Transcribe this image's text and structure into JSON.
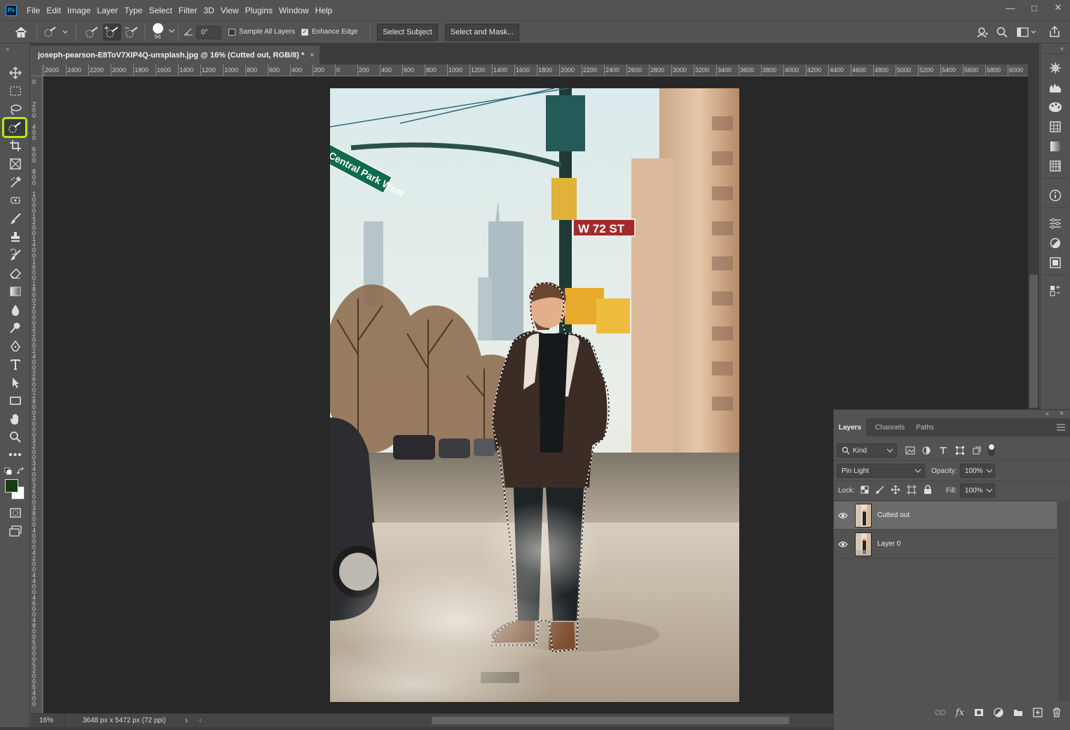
{
  "app": {
    "logo_text": "Ps",
    "menu": [
      "File",
      "Edit",
      "Image",
      "Layer",
      "Type",
      "Select",
      "Filter",
      "3D",
      "View",
      "Plugins",
      "Window",
      "Help"
    ],
    "window_controls": [
      "minimize-icon",
      "restore-icon",
      "close-icon"
    ]
  },
  "options": {
    "brush_size": "94",
    "angle": "0°",
    "sample_all_layers_label": "Sample All Layers",
    "sample_all_layers_checked": false,
    "enhance_edge_label": "Enhance Edge",
    "enhance_edge_checked": true,
    "select_subject_label": "Select Subject",
    "select_and_mask_label": "Select and Mask..."
  },
  "document": {
    "tab_title": "joseph-pearson-E8ToV7XIP4Q-unsplash.jpg @ 16% (Cutted out, RGB/8) *",
    "zoom": "16%",
    "doc_info": "3648 px x 5472 px (72 ppi)"
  },
  "rulers": {
    "horizontal": [
      "2600",
      "2400",
      "2200",
      "2000",
      "1800",
      "1600",
      "1400",
      "1200",
      "1000",
      "800",
      "600",
      "400",
      "200",
      "0",
      "200",
      "400",
      "600",
      "800",
      "1000",
      "1200",
      "1400",
      "1600",
      "1800",
      "2000",
      "2200",
      "2400",
      "2600",
      "2800",
      "3000",
      "3200",
      "3400",
      "3600",
      "3800",
      "4000",
      "4200",
      "4400",
      "4600",
      "4800",
      "5000",
      "5200",
      "5400",
      "5600",
      "5800",
      "6000"
    ],
    "vertical": [
      "0",
      "2 0 0",
      "4 0 0",
      "6 0 0",
      "8 0 0",
      "1 0 0 0",
      "1 2 0 0",
      "1 4 0 0",
      "1 6 0 0",
      "1 8 0 0",
      "2 0 0 0",
      "2 2 0 0",
      "2 4 0 0",
      "2 6 0 0",
      "2 8 0 0",
      "3 0 0 0",
      "3 2 0 0",
      "3 4 0 0",
      "3 6 0 0",
      "3 8 0 0",
      "4 0 0 0",
      "4 2 0 0",
      "4 4 0 0",
      "4 6 0 0",
      "4 8 0 0",
      "5 0 0 0",
      "5 2 0 0",
      "5 4 0 0"
    ]
  },
  "photo_signs": {
    "street_sign": "Central Park West",
    "cross_sign": "W 72 ST"
  },
  "layers_panel": {
    "tabs": [
      "Layers",
      "Channels",
      "Paths"
    ],
    "filter_kind": "Kind",
    "blend_mode": "Pin Light",
    "opacity_label": "Opacity:",
    "opacity_value": "100%",
    "lock_label": "Lock:",
    "fill_label": "Fill:",
    "fill_value": "100%",
    "layers": [
      {
        "name": "Cutted out",
        "selected": true,
        "visible": true
      },
      {
        "name": "Layer 0",
        "selected": false,
        "visible": true
      }
    ]
  },
  "colors": {
    "active_tool_highlight": "#b6e81f",
    "foreground_color": "#1c3a12",
    "background_color": "#ffffff"
  }
}
